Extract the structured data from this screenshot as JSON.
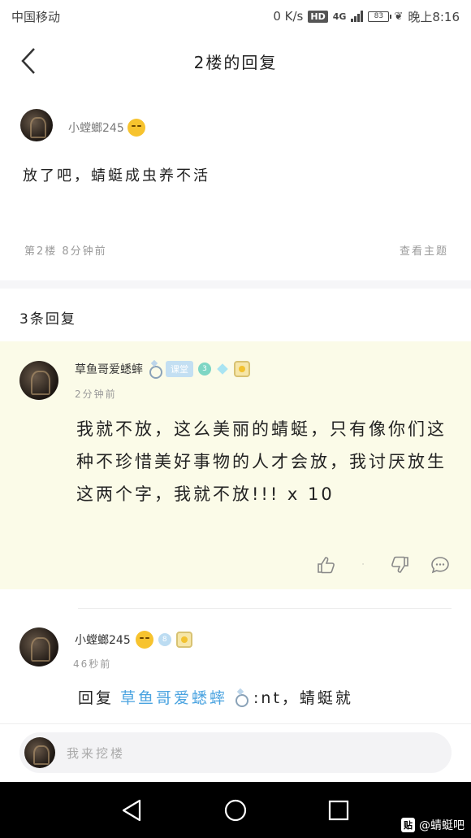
{
  "status_bar": {
    "carrier": "中国移动",
    "speed": "0 K/s",
    "hd": "HD",
    "network": "4G",
    "battery": "83",
    "time": "晚上8:16"
  },
  "header": {
    "title": "2楼的回复"
  },
  "main_post": {
    "username": "小螳螂245",
    "content": "放了吧，蜻蜓成虫养不活",
    "meta": "第2楼  8分钟前",
    "author_link": "查看主题"
  },
  "reply_count": "3条回复",
  "replies": [
    {
      "username": "草鱼哥爱蟋蟀",
      "tag": "课堂",
      "level": "3",
      "time": "2分钟前",
      "content": "我就不放，这么美丽的蜻蜓，只有像你们这种不珍惜美好事物的人才会放，我讨厌放生这两个字，我就不放!!! x 10"
    },
    {
      "username": "小螳螂245",
      "level": "8",
      "time": "46秒前",
      "prefix": "回复",
      "mention": "草鱼哥爱蟋蟀",
      "content": ":nt，蜻蜓就"
    }
  ],
  "input": {
    "placeholder": "我来挖楼"
  },
  "watermark": {
    "icon": "贴",
    "text": "@蜻蜓吧"
  },
  "icons": {
    "back": "chevron-left-icon",
    "like": "thumbs-up-icon",
    "dislike": "thumbs-down-icon",
    "comment": "comment-icon",
    "nav_back": "triangle-back-icon",
    "nav_home": "circle-home-icon",
    "nav_recent": "square-recent-icon"
  }
}
